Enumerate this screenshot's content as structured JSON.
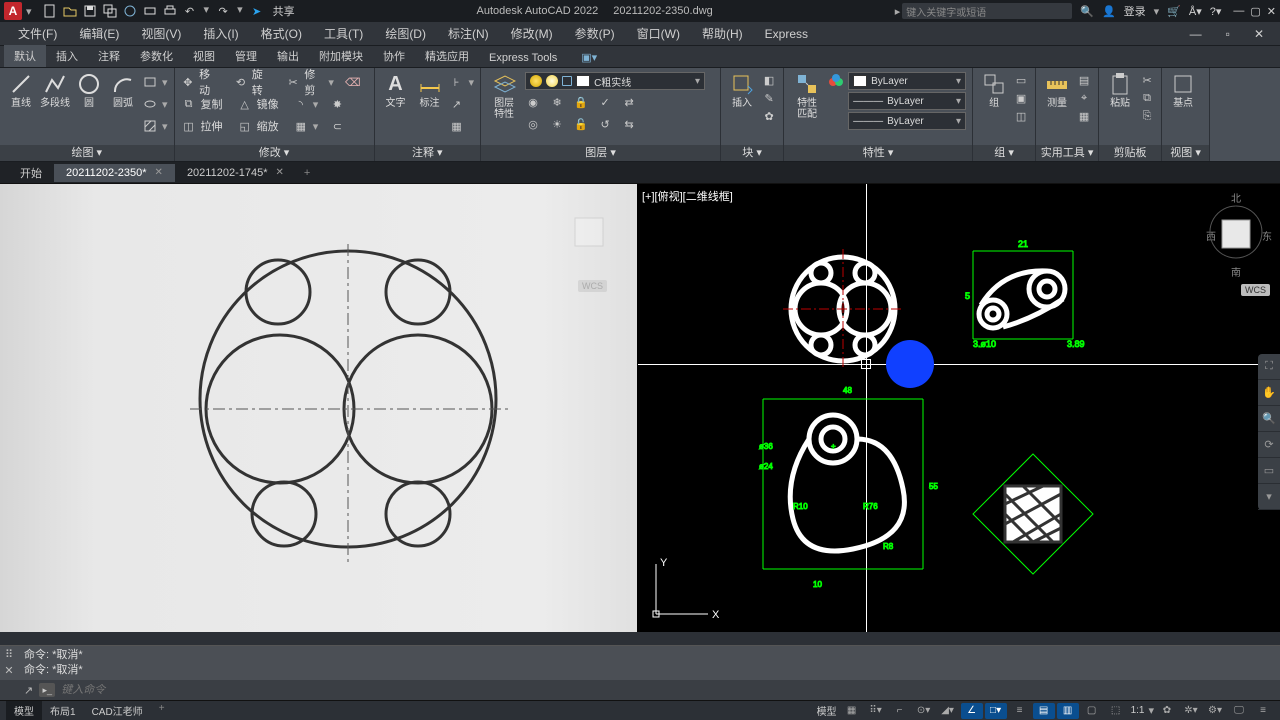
{
  "title": {
    "app": "Autodesk AutoCAD 2022",
    "doc": "20211202-2350.dwg",
    "share": "共享"
  },
  "search_placeholder": "键入关键字或短语",
  "account": "登录",
  "menu": [
    "文件(F)",
    "编辑(E)",
    "视图(V)",
    "插入(I)",
    "格式(O)",
    "工具(T)",
    "绘图(D)",
    "标注(N)",
    "修改(M)",
    "参数(P)",
    "窗口(W)",
    "帮助(H)",
    "Express"
  ],
  "ribbon_tabs": [
    "默认",
    "插入",
    "注释",
    "参数化",
    "视图",
    "管理",
    "输出",
    "附加模块",
    "协作",
    "精选应用",
    "Express Tools"
  ],
  "ribbon_active": "默认",
  "panels": {
    "draw": {
      "title": "绘图 ▾",
      "line": "直线",
      "pline": "多段线",
      "circle": "圆",
      "arc": "圆弧"
    },
    "modify": {
      "title": "修改 ▾",
      "move": "移动",
      "rotate": "旋转",
      "trim": "修剪",
      "copy": "复制",
      "mirror": "镜像",
      "fillet": "",
      "stretch": "拉伸",
      "scale": "缩放",
      "array": ""
    },
    "annot": {
      "title": "注释 ▾",
      "text": "文字",
      "dim": "标注"
    },
    "layer": {
      "title": "图层 ▾",
      "props": "图层\n特性",
      "current": "C粗实线"
    },
    "block": {
      "title": "块 ▾",
      "insert": "插入"
    },
    "props": {
      "title": "特性 ▾",
      "match": "特性\n匹配",
      "bylayer": "ByLayer"
    },
    "group": {
      "title": "组 ▾",
      "label": "组"
    },
    "util": {
      "title": "实用工具 ▾",
      "meas": "测量"
    },
    "clip": {
      "title": "剪贴板",
      "paste": "粘贴"
    },
    "base": {
      "title": "视图 ▾",
      "label": "基点"
    }
  },
  "filetabs": {
    "start": "开始",
    "t1": "20211202-2350*",
    "t2": "20211202-1745*"
  },
  "viewport_label": "[+][俯视][二维线框]",
  "viewcube": {
    "n": "北",
    "s": "南",
    "e": "东",
    "w": "西",
    "wcs": "WCS"
  },
  "ucs": {
    "x": "X",
    "y": "Y"
  },
  "cmd": {
    "h1": "命令: *取消*",
    "h2": "命令: *取消*",
    "placeholder": "键入命令"
  },
  "status": {
    "model": "模型",
    "layout1": "布局1",
    "teacher": "CAD江老师",
    "modeltab": "模型",
    "scale": "1:1",
    "gear": "✿"
  }
}
